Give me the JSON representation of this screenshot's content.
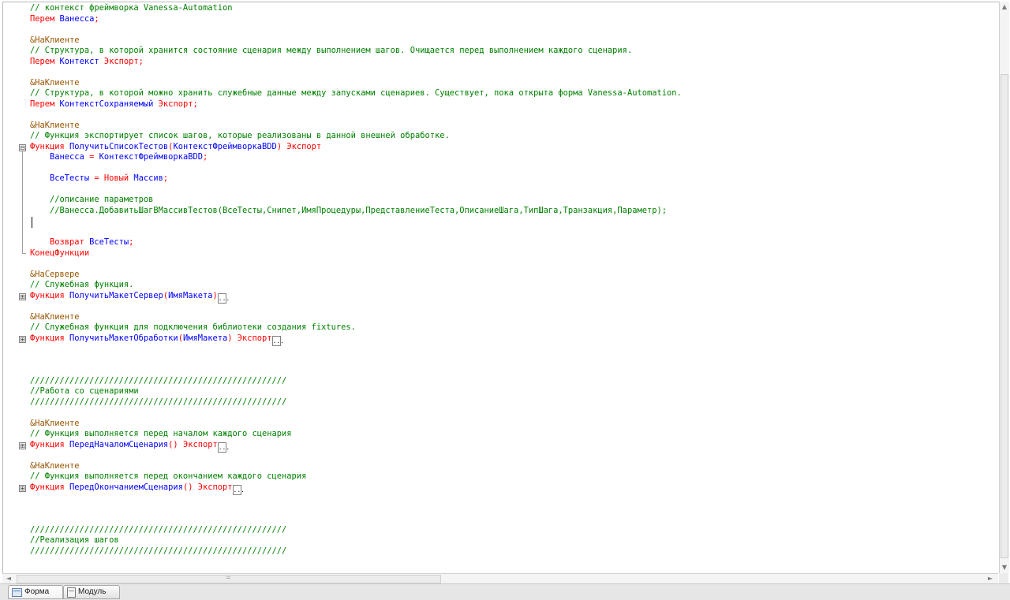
{
  "editor": {
    "lines": [
      {
        "tokens": [
          {
            "t": "// контекст фреймворка Vanessa-Automation",
            "c": "c"
          }
        ]
      },
      {
        "tokens": [
          {
            "t": "Перем ",
            "c": "k"
          },
          {
            "t": "Ванесса",
            "c": "i"
          },
          {
            "t": ";",
            "c": "k"
          }
        ]
      },
      {
        "tokens": []
      },
      {
        "tokens": [
          {
            "t": "&НаКлиенте",
            "c": "d"
          }
        ]
      },
      {
        "tokens": [
          {
            "t": "// Структура, в которой хранится состояние сценария между выполнением шагов. Очищается перед выполнением каждого сценария.",
            "c": "c"
          }
        ]
      },
      {
        "tokens": [
          {
            "t": "Перем ",
            "c": "k"
          },
          {
            "t": "Контекст ",
            "c": "i"
          },
          {
            "t": "Экспорт;",
            "c": "k"
          }
        ]
      },
      {
        "tokens": []
      },
      {
        "tokens": [
          {
            "t": "&НаКлиенте",
            "c": "d"
          }
        ]
      },
      {
        "tokens": [
          {
            "t": "// Структура, в которой можно хранить служебные данные между запусками сценариев. Существует, пока открыта форма Vanessa-Automation.",
            "c": "c"
          }
        ]
      },
      {
        "tokens": [
          {
            "t": "Перем ",
            "c": "k"
          },
          {
            "t": "КонтекстСохраняемый ",
            "c": "i"
          },
          {
            "t": "Экспорт;",
            "c": "k"
          }
        ]
      },
      {
        "tokens": []
      },
      {
        "tokens": [
          {
            "t": "&НаКлиенте",
            "c": "d"
          }
        ]
      },
      {
        "tokens": [
          {
            "t": "// Функция экспортирует список шагов, которые реализованы в данной внешней обработке.",
            "c": "c"
          }
        ]
      },
      {
        "tokens": [
          {
            "t": "Функция ",
            "c": "k"
          },
          {
            "t": "ПолучитьСписокТестов",
            "c": "i"
          },
          {
            "t": "(",
            "c": "k"
          },
          {
            "t": "КонтекстФреймворкаBDD",
            "c": "i"
          },
          {
            "t": ") Экспорт",
            "c": "k"
          }
        ],
        "fold": "open"
      },
      {
        "tokens": [
          {
            "t": "    Ванесса ",
            "c": "i"
          },
          {
            "t": "= ",
            "c": "k"
          },
          {
            "t": "КонтекстФреймворкаBDD",
            "c": "i"
          },
          {
            "t": ";",
            "c": "k"
          }
        ]
      },
      {
        "tokens": []
      },
      {
        "tokens": [
          {
            "t": "    ВсеТесты ",
            "c": "i"
          },
          {
            "t": "= Новый ",
            "c": "k"
          },
          {
            "t": "Массив",
            "c": "i"
          },
          {
            "t": ";",
            "c": "k"
          }
        ]
      },
      {
        "tokens": []
      },
      {
        "tokens": [
          {
            "t": "    //описание параметров",
            "c": "c"
          }
        ]
      },
      {
        "tokens": [
          {
            "t": "    //Ванесса.ДобавитьШагВМассивТестов(ВсеТесты,Снипет,ИмяПроцедуры,ПредставлениеТеста,ОписаниеШага,ТипШага,Транзакция,Параметр);",
            "c": "c"
          }
        ]
      },
      {
        "tokens": []
      },
      {
        "tokens": []
      },
      {
        "tokens": [
          {
            "t": "    Возврат ",
            "c": "k"
          },
          {
            "t": "ВсеТесты",
            "c": "i"
          },
          {
            "t": ";",
            "c": "k"
          }
        ]
      },
      {
        "tokens": [
          {
            "t": "КонецФункции",
            "c": "k"
          }
        ],
        "fold": "end"
      },
      {
        "tokens": []
      },
      {
        "tokens": [
          {
            "t": "&НаСервере",
            "c": "d"
          }
        ]
      },
      {
        "tokens": [
          {
            "t": "// Служебная функция.",
            "c": "c"
          }
        ]
      },
      {
        "tokens": [
          {
            "t": "Функция ",
            "c": "k"
          },
          {
            "t": "ПолучитьМакетСервер",
            "c": "i"
          },
          {
            "t": "(",
            "c": "k"
          },
          {
            "t": "ИмяМакета",
            "c": "i"
          },
          {
            "t": ")",
            "c": "k"
          }
        ],
        "fold": "closed"
      },
      {
        "tokens": []
      },
      {
        "tokens": [
          {
            "t": "&НаКлиенте",
            "c": "d"
          }
        ]
      },
      {
        "tokens": [
          {
            "t": "// Служебная функция для подключения библиотеки создания fixtures.",
            "c": "c"
          }
        ]
      },
      {
        "tokens": [
          {
            "t": "Функция ",
            "c": "k"
          },
          {
            "t": "ПолучитьМакетОбработки",
            "c": "i"
          },
          {
            "t": "(",
            "c": "k"
          },
          {
            "t": "ИмяМакета",
            "c": "i"
          },
          {
            "t": ") Экспорт",
            "c": "k"
          }
        ],
        "fold": "closed"
      },
      {
        "tokens": []
      },
      {
        "tokens": []
      },
      {
        "tokens": []
      },
      {
        "tokens": [
          {
            "t": "////////////////////////////////////////////////////",
            "c": "c"
          }
        ]
      },
      {
        "tokens": [
          {
            "t": "//Работа со сценариями",
            "c": "c"
          }
        ]
      },
      {
        "tokens": [
          {
            "t": "////////////////////////////////////////////////////",
            "c": "c"
          }
        ]
      },
      {
        "tokens": []
      },
      {
        "tokens": [
          {
            "t": "&НаКлиенте",
            "c": "d"
          }
        ]
      },
      {
        "tokens": [
          {
            "t": "// Функция выполняется перед началом каждого сценария",
            "c": "c"
          }
        ]
      },
      {
        "tokens": [
          {
            "t": "Функция ",
            "c": "k"
          },
          {
            "t": "ПередНачаломСценария",
            "c": "i"
          },
          {
            "t": "() Экспорт",
            "c": "k"
          }
        ],
        "fold": "closed"
      },
      {
        "tokens": []
      },
      {
        "tokens": [
          {
            "t": "&НаКлиенте",
            "c": "d"
          }
        ]
      },
      {
        "tokens": [
          {
            "t": "// Функция выполняется перед окончанием каждого сценария",
            "c": "c"
          }
        ]
      },
      {
        "tokens": [
          {
            "t": "Функция ",
            "c": "k"
          },
          {
            "t": "ПередОкончаниемСценария",
            "c": "i"
          },
          {
            "t": "() Экспорт",
            "c": "k"
          }
        ],
        "fold": "closed"
      },
      {
        "tokens": []
      },
      {
        "tokens": []
      },
      {
        "tokens": []
      },
      {
        "tokens": [
          {
            "t": "////////////////////////////////////////////////////",
            "c": "c"
          }
        ]
      },
      {
        "tokens": [
          {
            "t": "//Реализация шагов",
            "c": "c"
          }
        ]
      },
      {
        "tokens": [
          {
            "t": "////////////////////////////////////////////////////",
            "c": "c"
          }
        ]
      }
    ],
    "collapsed_marker": "...",
    "fold_open_glyph": "⊟",
    "fold_closed_glyph": "⊞"
  },
  "tabs": [
    {
      "label": "Форма",
      "icon": "form-icon",
      "active": true
    },
    {
      "label": "Модуль",
      "icon": "module-icon",
      "active": false
    }
  ],
  "scrollbar_glyphs": {
    "up": "▲",
    "down": "▼",
    "left": "◄",
    "right": "►",
    "grip": "="
  }
}
